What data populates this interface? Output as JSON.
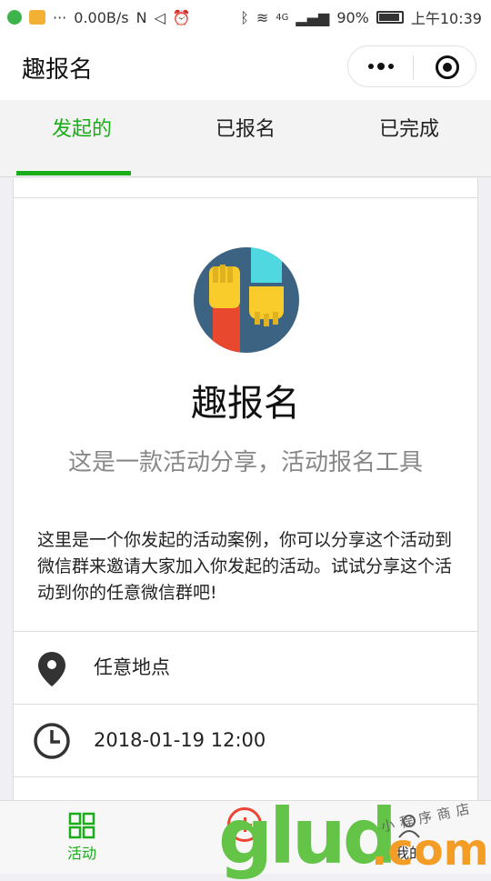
{
  "status_bar": {
    "speed": "0.00B/s",
    "network_type": "4G",
    "battery": "90%",
    "time": "上午10:39"
  },
  "nav": {
    "title": "趣报名"
  },
  "tabs": [
    {
      "label": "发起的",
      "active": true
    },
    {
      "label": "已报名",
      "active": false
    },
    {
      "label": "已完成",
      "active": false
    }
  ],
  "card": {
    "app_name": "趣报名",
    "tagline": "这是一款活动分享，活动报名工具",
    "description": "这里是一个你发起的活动案例，你可以分享这个活动到微信群来邀请大家加入你发起的活动。试试分享这个活动到你的任意微信群吧!",
    "location": "任意地点",
    "datetime": "2018-01-19 12:00"
  },
  "tab_bar": {
    "items": [
      {
        "label": "活动",
        "icon": "grid-icon",
        "active": true
      },
      {
        "label": "",
        "icon": "add-circle-icon",
        "active": false
      },
      {
        "label": "我的",
        "icon": "user-icon",
        "active": false
      }
    ]
  },
  "watermark": {
    "brand": "glud",
    "suffix": ".com",
    "small_text": "小程序商店"
  },
  "colors": {
    "accent": "#1aad19",
    "logo_bg": "#3d6383",
    "logo_yellow": "#f9cc2c",
    "logo_red": "#e8492e",
    "logo_cyan": "#4fd8e0"
  }
}
